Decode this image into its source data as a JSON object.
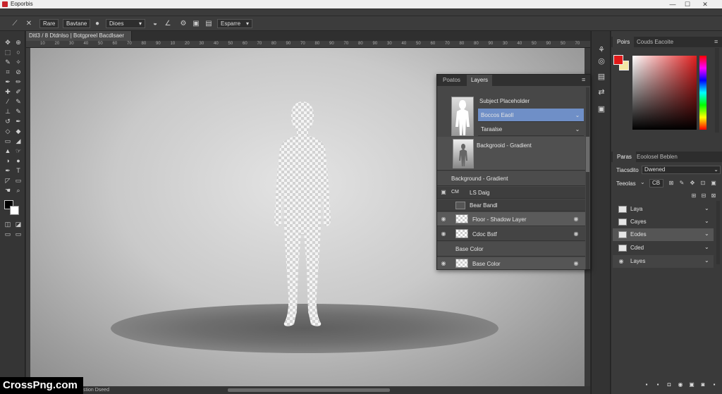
{
  "window": {
    "title": "Eoporbis",
    "controls": [
      "—",
      "☐",
      "✕"
    ]
  },
  "options_bar": {
    "buttons": [
      "Rare",
      "Bavtane",
      "Dioes",
      "Esparre"
    ],
    "dropdown_value_1": "Dioes",
    "dropdown_value_2": "Esparre"
  },
  "document": {
    "tab_label": "Ditl3 / 8 Dtdnlso | Botgpreel Bacdlsaer"
  },
  "ruler_ticks": [
    "10",
    "20",
    "30",
    "40",
    "50",
    "60",
    "70",
    "80",
    "90",
    "10",
    "20",
    "30",
    "40",
    "50",
    "60",
    "70",
    "80",
    "90",
    "70",
    "80",
    "90",
    "70",
    "80",
    "90",
    "30",
    "40",
    "50",
    "60",
    "70",
    "80",
    "80",
    "90",
    "30",
    "40",
    "50",
    "90",
    "50",
    "70"
  ],
  "layers_panel": {
    "tabs": [
      "Poatos",
      "Layers"
    ],
    "active_tab": "Layers",
    "rows": [
      {
        "label": "Subject Placeholder",
        "type": "header"
      },
      {
        "label": "Boccos Eaoll",
        "selected": true
      },
      {
        "label": "Taraalse"
      },
      {
        "label": "Backgrooid - Gradient"
      },
      {
        "label": "Background - Gradient",
        "type": "section"
      },
      {
        "label": "LS Daig",
        "prefix": "CM"
      },
      {
        "label": "Bear Bandl"
      },
      {
        "label": "Floor - Shadow Layer"
      },
      {
        "label": "Cdoc Bstf"
      },
      {
        "label": "Base Color",
        "type": "section"
      },
      {
        "label": "Base Color"
      }
    ]
  },
  "color_panel": {
    "tabs": [
      "Poirs",
      "Couds Eacoite"
    ],
    "foreground": "#e11919",
    "background": "#f2e7a4"
  },
  "lower_panel": {
    "tabs": [
      "Paras",
      "Eoolosel Beblen"
    ],
    "field1_label": "Tiacsdito",
    "field1_value": "Dwened",
    "field2_label": "Teeolas",
    "field2_value": "CB",
    "rows": [
      "Laya",
      "Cayes",
      "Eodes",
      "Cded",
      "Layes"
    ]
  },
  "watermark": "CrossPng.com",
  "status_text": "stion Dseed"
}
